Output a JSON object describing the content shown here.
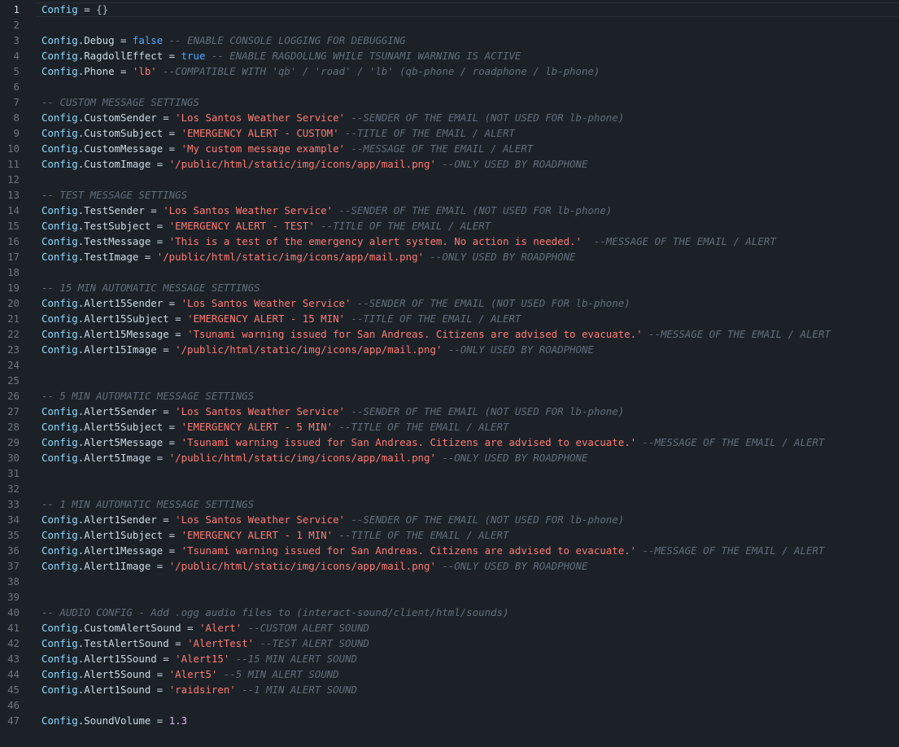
{
  "editor": {
    "colors": {
      "background": "#1c2128",
      "line_number": "#6e7681",
      "identifier": "#8ddbff",
      "keyword": "#4fa8ff",
      "string": "#ff7b72",
      "number": "#d9b3ff",
      "comment": "#636e7b"
    },
    "active_line": 1,
    "lines": [
      {
        "n": "1",
        "tokens": [
          {
            "t": "Config",
            "k": "var"
          },
          {
            "t": " = ",
            "k": "text"
          },
          {
            "t": "{}",
            "k": "punct"
          }
        ]
      },
      {
        "n": "2",
        "tokens": []
      },
      {
        "n": "3",
        "tokens": [
          {
            "t": "Config",
            "k": "var"
          },
          {
            "t": ".Debug",
            "k": "text"
          },
          {
            "t": " = ",
            "k": "text"
          },
          {
            "t": "false",
            "k": "kw"
          },
          {
            "t": " -- ENABLE CONSOLE LOGGING FOR DEBUGGING",
            "k": "cm"
          }
        ]
      },
      {
        "n": "4",
        "tokens": [
          {
            "t": "Config",
            "k": "var"
          },
          {
            "t": ".RagdollEffect",
            "k": "text"
          },
          {
            "t": " = ",
            "k": "text"
          },
          {
            "t": "true",
            "k": "kw"
          },
          {
            "t": " -- ENABLE RAGDOLLNG WHILE TSUNAMI WARNING IS ACTIVE",
            "k": "cm"
          }
        ]
      },
      {
        "n": "5",
        "tokens": [
          {
            "t": "Config",
            "k": "var"
          },
          {
            "t": ".Phone",
            "k": "text"
          },
          {
            "t": " = ",
            "k": "text"
          },
          {
            "t": "'lb'",
            "k": "str"
          },
          {
            "t": " --COMPATIBLE WITH 'qb' / 'road' / 'lb' (qb-phone / roadphone / lb-phone)",
            "k": "cm"
          }
        ]
      },
      {
        "n": "6",
        "tokens": []
      },
      {
        "n": "7",
        "tokens": [
          {
            "t": "-- CUSTOM MESSAGE SETTINGS",
            "k": "cm"
          }
        ]
      },
      {
        "n": "8",
        "tokens": [
          {
            "t": "Config",
            "k": "var"
          },
          {
            "t": ".CustomSender",
            "k": "text"
          },
          {
            "t": " = ",
            "k": "text"
          },
          {
            "t": "'Los Santos Weather Service'",
            "k": "str"
          },
          {
            "t": " --SENDER OF THE EMAIL (NOT USED FOR lb-phone)",
            "k": "cm"
          }
        ]
      },
      {
        "n": "9",
        "tokens": [
          {
            "t": "Config",
            "k": "var"
          },
          {
            "t": ".CustomSubject",
            "k": "text"
          },
          {
            "t": " = ",
            "k": "text"
          },
          {
            "t": "'EMERGENCY ALERT - CUSTOM'",
            "k": "str"
          },
          {
            "t": " --TITLE OF THE EMAIL / ALERT",
            "k": "cm"
          }
        ]
      },
      {
        "n": "10",
        "tokens": [
          {
            "t": "Config",
            "k": "var"
          },
          {
            "t": ".CustomMessage",
            "k": "text"
          },
          {
            "t": " = ",
            "k": "text"
          },
          {
            "t": "'My custom message example'",
            "k": "str"
          },
          {
            "t": " --MESSAGE OF THE EMAIL / ALERT",
            "k": "cm"
          }
        ]
      },
      {
        "n": "11",
        "tokens": [
          {
            "t": "Config",
            "k": "var"
          },
          {
            "t": ".CustomImage",
            "k": "text"
          },
          {
            "t": " = ",
            "k": "text"
          },
          {
            "t": "'/public/html/static/img/icons/app/mail.png'",
            "k": "str"
          },
          {
            "t": " --ONLY USED BY ROADPHONE",
            "k": "cm"
          }
        ]
      },
      {
        "n": "12",
        "tokens": []
      },
      {
        "n": "13",
        "tokens": [
          {
            "t": "-- TEST MESSAGE SETTINGS",
            "k": "cm"
          }
        ]
      },
      {
        "n": "14",
        "tokens": [
          {
            "t": "Config",
            "k": "var"
          },
          {
            "t": ".TestSender",
            "k": "text"
          },
          {
            "t": " = ",
            "k": "text"
          },
          {
            "t": "'Los Santos Weather Service'",
            "k": "str"
          },
          {
            "t": " --SENDER OF THE EMAIL (NOT USED FOR lb-phone)",
            "k": "cm"
          }
        ]
      },
      {
        "n": "15",
        "tokens": [
          {
            "t": "Config",
            "k": "var"
          },
          {
            "t": ".TestSubject",
            "k": "text"
          },
          {
            "t": " = ",
            "k": "text"
          },
          {
            "t": "'EMERGENCY ALERT - TEST'",
            "k": "str"
          },
          {
            "t": " --TITLE OF THE EMAIL / ALERT",
            "k": "cm"
          }
        ]
      },
      {
        "n": "16",
        "tokens": [
          {
            "t": "Config",
            "k": "var"
          },
          {
            "t": ".TestMessage",
            "k": "text"
          },
          {
            "t": " = ",
            "k": "text"
          },
          {
            "t": "'This is a test of the emergency alert system. No action is needed.'",
            "k": "str"
          },
          {
            "t": "  --MESSAGE OF THE EMAIL / ALERT",
            "k": "cm"
          }
        ]
      },
      {
        "n": "17",
        "tokens": [
          {
            "t": "Config",
            "k": "var"
          },
          {
            "t": ".TestImage",
            "k": "text"
          },
          {
            "t": " = ",
            "k": "text"
          },
          {
            "t": "'/public/html/static/img/icons/app/mail.png'",
            "k": "str"
          },
          {
            "t": " --ONLY USED BY ROADPHONE",
            "k": "cm"
          }
        ]
      },
      {
        "n": "18",
        "tokens": []
      },
      {
        "n": "19",
        "tokens": [
          {
            "t": "-- 15 MIN AUTOMATIC MESSAGE SETTINGS",
            "k": "cm"
          }
        ]
      },
      {
        "n": "20",
        "tokens": [
          {
            "t": "Config",
            "k": "var"
          },
          {
            "t": ".Alert15Sender",
            "k": "text"
          },
          {
            "t": " = ",
            "k": "text"
          },
          {
            "t": "'Los Santos Weather Service'",
            "k": "str"
          },
          {
            "t": " --SENDER OF THE EMAIL (NOT USED FOR lb-phone)",
            "k": "cm"
          }
        ]
      },
      {
        "n": "21",
        "tokens": [
          {
            "t": "Config",
            "k": "var"
          },
          {
            "t": ".Alert15Subject",
            "k": "text"
          },
          {
            "t": " = ",
            "k": "text"
          },
          {
            "t": "'EMERGENCY ALERT - 15 MIN'",
            "k": "str"
          },
          {
            "t": " --TITLE OF THE EMAIL / ALERT",
            "k": "cm"
          }
        ]
      },
      {
        "n": "22",
        "tokens": [
          {
            "t": "Config",
            "k": "var"
          },
          {
            "t": ".Alert15Message",
            "k": "text"
          },
          {
            "t": " = ",
            "k": "text"
          },
          {
            "t": "'Tsunami warning issued for San Andreas. Citizens are advised to evacuate.'",
            "k": "str"
          },
          {
            "t": " --MESSAGE OF THE EMAIL / ALERT",
            "k": "cm"
          }
        ]
      },
      {
        "n": "23",
        "tokens": [
          {
            "t": "Config",
            "k": "var"
          },
          {
            "t": ".Alert15Image",
            "k": "text"
          },
          {
            "t": " = ",
            "k": "text"
          },
          {
            "t": "'/public/html/static/img/icons/app/mail.png'",
            "k": "str"
          },
          {
            "t": " --ONLY USED BY ROADPHONE",
            "k": "cm"
          }
        ]
      },
      {
        "n": "24",
        "tokens": []
      },
      {
        "n": "25",
        "tokens": []
      },
      {
        "n": "26",
        "tokens": [
          {
            "t": "-- 5 MIN AUTOMATIC MESSAGE SETTINGS",
            "k": "cm"
          }
        ]
      },
      {
        "n": "27",
        "tokens": [
          {
            "t": "Config",
            "k": "var"
          },
          {
            "t": ".Alert5Sender",
            "k": "text"
          },
          {
            "t": " = ",
            "k": "text"
          },
          {
            "t": "'Los Santos Weather Service'",
            "k": "str"
          },
          {
            "t": " --SENDER OF THE EMAIL (NOT USED FOR lb-phone)",
            "k": "cm"
          }
        ]
      },
      {
        "n": "28",
        "tokens": [
          {
            "t": "Config",
            "k": "var"
          },
          {
            "t": ".Alert5Subject",
            "k": "text"
          },
          {
            "t": " = ",
            "k": "text"
          },
          {
            "t": "'EMERGENCY ALERT - 5 MIN'",
            "k": "str"
          },
          {
            "t": " --TITLE OF THE EMAIL / ALERT",
            "k": "cm"
          }
        ]
      },
      {
        "n": "29",
        "tokens": [
          {
            "t": "Config",
            "k": "var"
          },
          {
            "t": ".Alert5Message",
            "k": "text"
          },
          {
            "t": " = ",
            "k": "text"
          },
          {
            "t": "'Tsunami warning issued for San Andreas. Citizens are advised to evacuate.'",
            "k": "str"
          },
          {
            "t": " --MESSAGE OF THE EMAIL / ALERT",
            "k": "cm"
          }
        ]
      },
      {
        "n": "30",
        "tokens": [
          {
            "t": "Config",
            "k": "var"
          },
          {
            "t": ".Alert5Image",
            "k": "text"
          },
          {
            "t": " = ",
            "k": "text"
          },
          {
            "t": "'/public/html/static/img/icons/app/mail.png'",
            "k": "str"
          },
          {
            "t": " --ONLY USED BY ROADPHONE",
            "k": "cm"
          }
        ]
      },
      {
        "n": "31",
        "tokens": []
      },
      {
        "n": "32",
        "tokens": []
      },
      {
        "n": "33",
        "tokens": [
          {
            "t": "-- 1 MIN AUTOMATIC MESSAGE SETTINGS",
            "k": "cm"
          }
        ]
      },
      {
        "n": "34",
        "tokens": [
          {
            "t": "Config",
            "k": "var"
          },
          {
            "t": ".Alert1Sender",
            "k": "text"
          },
          {
            "t": " = ",
            "k": "text"
          },
          {
            "t": "'Los Santos Weather Service'",
            "k": "str"
          },
          {
            "t": " --SENDER OF THE EMAIL (NOT USED FOR lb-phone)",
            "k": "cm"
          }
        ]
      },
      {
        "n": "35",
        "tokens": [
          {
            "t": "Config",
            "k": "var"
          },
          {
            "t": ".Alert1Subject",
            "k": "text"
          },
          {
            "t": " = ",
            "k": "text"
          },
          {
            "t": "'EMERGENCY ALERT - 1 MIN'",
            "k": "str"
          },
          {
            "t": " --TITLE OF THE EMAIL / ALERT",
            "k": "cm"
          }
        ]
      },
      {
        "n": "36",
        "tokens": [
          {
            "t": "Config",
            "k": "var"
          },
          {
            "t": ".Alert1Message",
            "k": "text"
          },
          {
            "t": " = ",
            "k": "text"
          },
          {
            "t": "'Tsunami warning issued for San Andreas. Citizens are advised to evacuate.'",
            "k": "str"
          },
          {
            "t": " --MESSAGE OF THE EMAIL / ALERT",
            "k": "cm"
          }
        ]
      },
      {
        "n": "37",
        "tokens": [
          {
            "t": "Config",
            "k": "var"
          },
          {
            "t": ".Alert1Image",
            "k": "text"
          },
          {
            "t": " = ",
            "k": "text"
          },
          {
            "t": "'/public/html/static/img/icons/app/mail.png'",
            "k": "str"
          },
          {
            "t": " --ONLY USED BY ROADPHONE",
            "k": "cm"
          }
        ]
      },
      {
        "n": "38",
        "tokens": []
      },
      {
        "n": "39",
        "tokens": []
      },
      {
        "n": "40",
        "tokens": [
          {
            "t": "-- AUDIO CONFIG - Add .ogg audio files to (interact-sound/client/html/sounds)",
            "k": "cm"
          }
        ]
      },
      {
        "n": "41",
        "tokens": [
          {
            "t": "Config",
            "k": "var"
          },
          {
            "t": ".CustomAlertSound",
            "k": "text"
          },
          {
            "t": " = ",
            "k": "text"
          },
          {
            "t": "'Alert'",
            "k": "str"
          },
          {
            "t": " --CUSTOM ALERT SOUND",
            "k": "cm"
          }
        ]
      },
      {
        "n": "42",
        "tokens": [
          {
            "t": "Config",
            "k": "var"
          },
          {
            "t": ".TestAlertSound",
            "k": "text"
          },
          {
            "t": " = ",
            "k": "text"
          },
          {
            "t": "'AlertTest'",
            "k": "str"
          },
          {
            "t": " --TEST ALERT SOUND",
            "k": "cm"
          }
        ]
      },
      {
        "n": "43",
        "tokens": [
          {
            "t": "Config",
            "k": "var"
          },
          {
            "t": ".Alert15Sound",
            "k": "text"
          },
          {
            "t": " = ",
            "k": "text"
          },
          {
            "t": "'Alert15'",
            "k": "str"
          },
          {
            "t": " --15 MIN ALERT SOUND",
            "k": "cm"
          }
        ]
      },
      {
        "n": "44",
        "tokens": [
          {
            "t": "Config",
            "k": "var"
          },
          {
            "t": ".Alert5Sound",
            "k": "text"
          },
          {
            "t": " = ",
            "k": "text"
          },
          {
            "t": "'Alert5'",
            "k": "str"
          },
          {
            "t": " --5 MIN ALERT SOUND",
            "k": "cm"
          }
        ]
      },
      {
        "n": "45",
        "tokens": [
          {
            "t": "Config",
            "k": "var"
          },
          {
            "t": ".Alert1Sound",
            "k": "text"
          },
          {
            "t": " = ",
            "k": "text"
          },
          {
            "t": "'raidsiren'",
            "k": "str"
          },
          {
            "t": " --1 MIN ALERT SOUND",
            "k": "cm"
          }
        ]
      },
      {
        "n": "46",
        "tokens": []
      },
      {
        "n": "47",
        "tokens": [
          {
            "t": "Config",
            "k": "var"
          },
          {
            "t": ".SoundVolume",
            "k": "text"
          },
          {
            "t": " = ",
            "k": "text"
          },
          {
            "t": "1.3",
            "k": "num"
          }
        ]
      }
    ]
  }
}
